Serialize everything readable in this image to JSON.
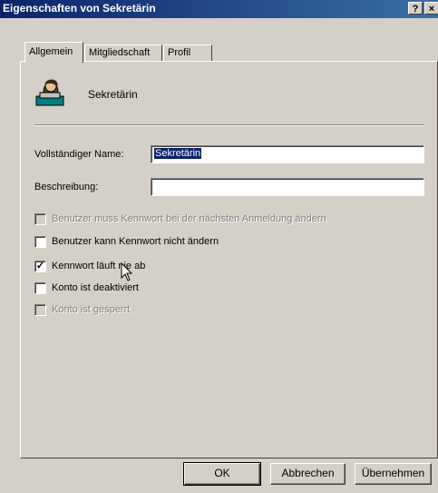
{
  "window": {
    "title": "Eigenschaften von Sekretärin",
    "help_btn": "?",
    "close_btn": "×"
  },
  "tabs": [
    {
      "label": "Allgemein",
      "active": true
    },
    {
      "label": "Mitgliedschaft",
      "active": false
    },
    {
      "label": "Profil",
      "active": false
    }
  ],
  "header": {
    "icon": "user-icon",
    "name": "Sekretärin"
  },
  "form": {
    "fullname_label": "Vollständiger Name:",
    "fullname_value": "Sekretärin",
    "description_label": "Beschreibung:",
    "description_value": ""
  },
  "options": [
    {
      "label": "Benutzer muss Kennwort bei der nächsten Anmeldung ändern",
      "checked": false,
      "enabled": false
    },
    {
      "label": "Benutzer kann Kennwort nicht ändern",
      "checked": false,
      "enabled": true
    },
    {
      "label": "Kennwort läuft nie ab",
      "checked": true,
      "enabled": true
    },
    {
      "label": "Konto ist deaktiviert",
      "checked": false,
      "enabled": true
    },
    {
      "label": "Konto ist gesperrt",
      "checked": false,
      "enabled": false
    }
  ],
  "buttons": {
    "ok": "OK",
    "cancel": "Abbrechen",
    "apply": "Übernehmen"
  }
}
